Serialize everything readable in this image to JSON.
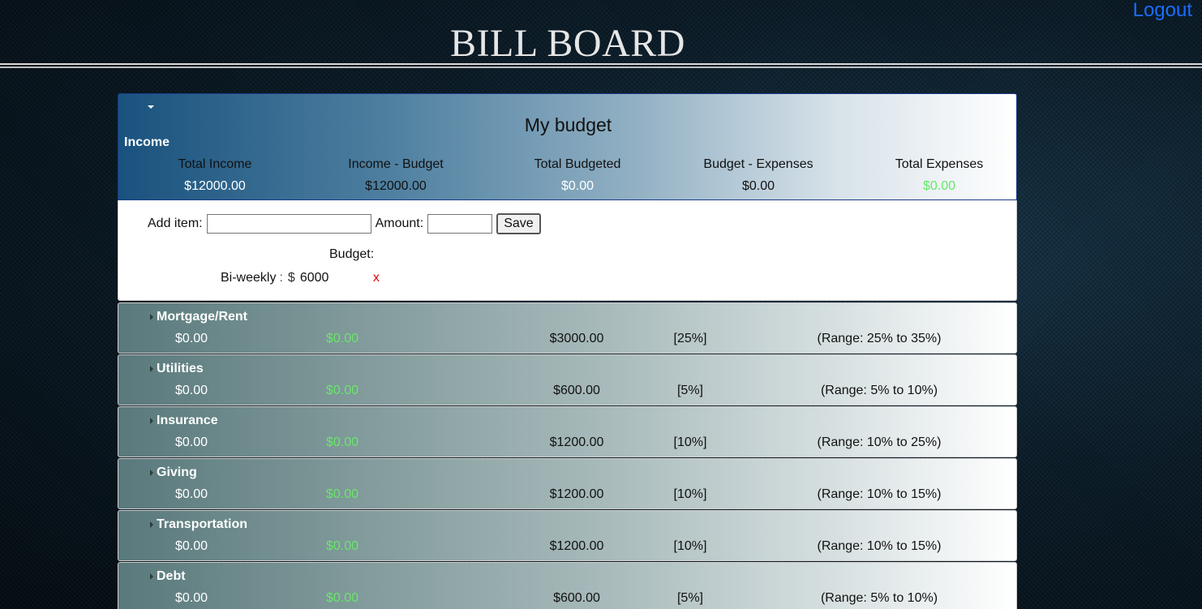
{
  "header": {
    "site_title": "BILL BOARD",
    "logout_label": "Logout"
  },
  "budget": {
    "title": "My budget",
    "section_label": "Income",
    "stats": [
      {
        "label": "Total Income",
        "value": "$12000.00",
        "color": "#ffffff"
      },
      {
        "label": "Income - Budget",
        "value": "$12000.00",
        "color": "#111111"
      },
      {
        "label": "Total Budgeted",
        "value": "$0.00",
        "color": "#ffffff"
      },
      {
        "label": "Budget - Expenses",
        "value": "$0.00",
        "color": "#111111"
      },
      {
        "label": "Total Expenses",
        "value": "$0.00",
        "color": "#67e867"
      }
    ]
  },
  "add_form": {
    "item_label": "Add item:",
    "item_value": "",
    "amount_label": "Amount:",
    "amount_value": "",
    "save_label": "Save"
  },
  "income_entries": {
    "budget_label": "Budget:",
    "items": [
      {
        "name": "Bi-weekly",
        "colon": ":",
        "currency": "$",
        "amount": "6000",
        "delete_label": "x"
      }
    ]
  },
  "categories": [
    {
      "name": "Mortgage/Rent",
      "spent": "$0.00",
      "remaining": "$0.00",
      "budgeted": "$3000.00",
      "percent": "[25%]",
      "range": "(Range: 25% to 35%)"
    },
    {
      "name": "Utilities",
      "spent": "$0.00",
      "remaining": "$0.00",
      "budgeted": "$600.00",
      "percent": "[5%]",
      "range": "(Range: 5% to 10%)"
    },
    {
      "name": "Insurance",
      "spent": "$0.00",
      "remaining": "$0.00",
      "budgeted": "$1200.00",
      "percent": "[10%]",
      "range": "(Range: 10% to 25%)"
    },
    {
      "name": "Giving",
      "spent": "$0.00",
      "remaining": "$0.00",
      "budgeted": "$1200.00",
      "percent": "[10%]",
      "range": "(Range: 10% to 15%)"
    },
    {
      "name": "Transportation",
      "spent": "$0.00",
      "remaining": "$0.00",
      "budgeted": "$1200.00",
      "percent": "[10%]",
      "range": "(Range: 10% to 15%)"
    },
    {
      "name": "Debt",
      "spent": "$0.00",
      "remaining": "$0.00",
      "budgeted": "$600.00",
      "percent": "[5%]",
      "range": "(Range: 5% to 10%)"
    }
  ],
  "colors": {
    "logout": "#1a6cff",
    "positive": "#67e867",
    "delete": "#e00000"
  }
}
